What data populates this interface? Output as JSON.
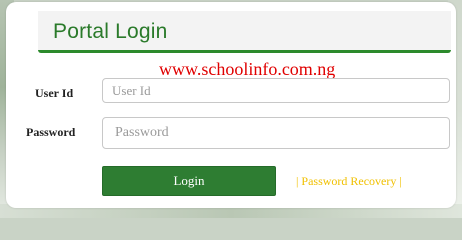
{
  "header": {
    "title": "Portal Login"
  },
  "watermark": {
    "text": "www.schoolinfo.com.ng"
  },
  "form": {
    "user_label": "User Id",
    "user_placeholder": "User Id",
    "password_label": "Password",
    "password_placeholder": "Password",
    "login_label": "Login",
    "recovery_link": "| Password Recovery |"
  },
  "colors": {
    "accent_green": "#2e7d32",
    "watermark_red": "#e00000",
    "link_yellow": "#f0c000"
  }
}
